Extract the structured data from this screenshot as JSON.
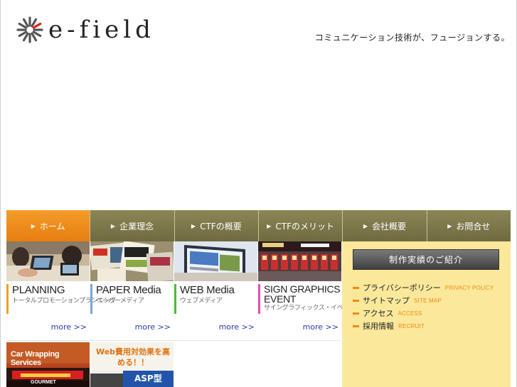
{
  "header": {
    "logo_text": "e-field",
    "tagline": "コミュニケーション技術が、フュージョンする。"
  },
  "nav": {
    "items": [
      {
        "label": "ホーム",
        "active": true
      },
      {
        "label": "企業理念",
        "active": false
      },
      {
        "label": "CTFの概要",
        "active": false
      },
      {
        "label": "CTFのメリット",
        "active": false
      },
      {
        "label": "会社概要",
        "active": false
      },
      {
        "label": "お問合せ",
        "active": false
      }
    ]
  },
  "services": [
    {
      "title": "PLANNING",
      "sub": "トータルプロモーションプランニング",
      "more": "more >>",
      "accent": "#f0a020"
    },
    {
      "title": "PAPER Media",
      "sub": "ペーパーメディア",
      "more": "more >>",
      "accent": "#7aa6d8"
    },
    {
      "title": "WEB Media",
      "sub": "ウェブメディア",
      "more": "more >>",
      "accent": "#4dbb3a"
    },
    {
      "title": "SIGN GRAPHICS EVENT",
      "sub": "サイングラフィックス・イベント",
      "more": "more >>",
      "accent": "#e050b0"
    }
  ],
  "banners": [
    {
      "text": "Car Wrapping Services",
      "sub": "GOURMET"
    },
    {
      "text": "Web費用対効果を高める！！",
      "sub": "ASP型"
    }
  ],
  "side": {
    "works_button": "制作実績のご紹介",
    "links": [
      {
        "jp": "プライバシーポリシー",
        "en": "PRIVACY POLICY"
      },
      {
        "jp": "サイトマップ",
        "en": "SITE MAP"
      },
      {
        "jp": "アクセス",
        "en": "ACCESS"
      },
      {
        "jp": "採用情報",
        "en": "RECRUIT"
      }
    ]
  },
  "colors": {
    "nav_active": "#e77d12",
    "nav_default": "#7d784a",
    "side_bg": "#fbe89b",
    "link_accent": "#f08a10",
    "more_link": "#2a3aa8"
  }
}
